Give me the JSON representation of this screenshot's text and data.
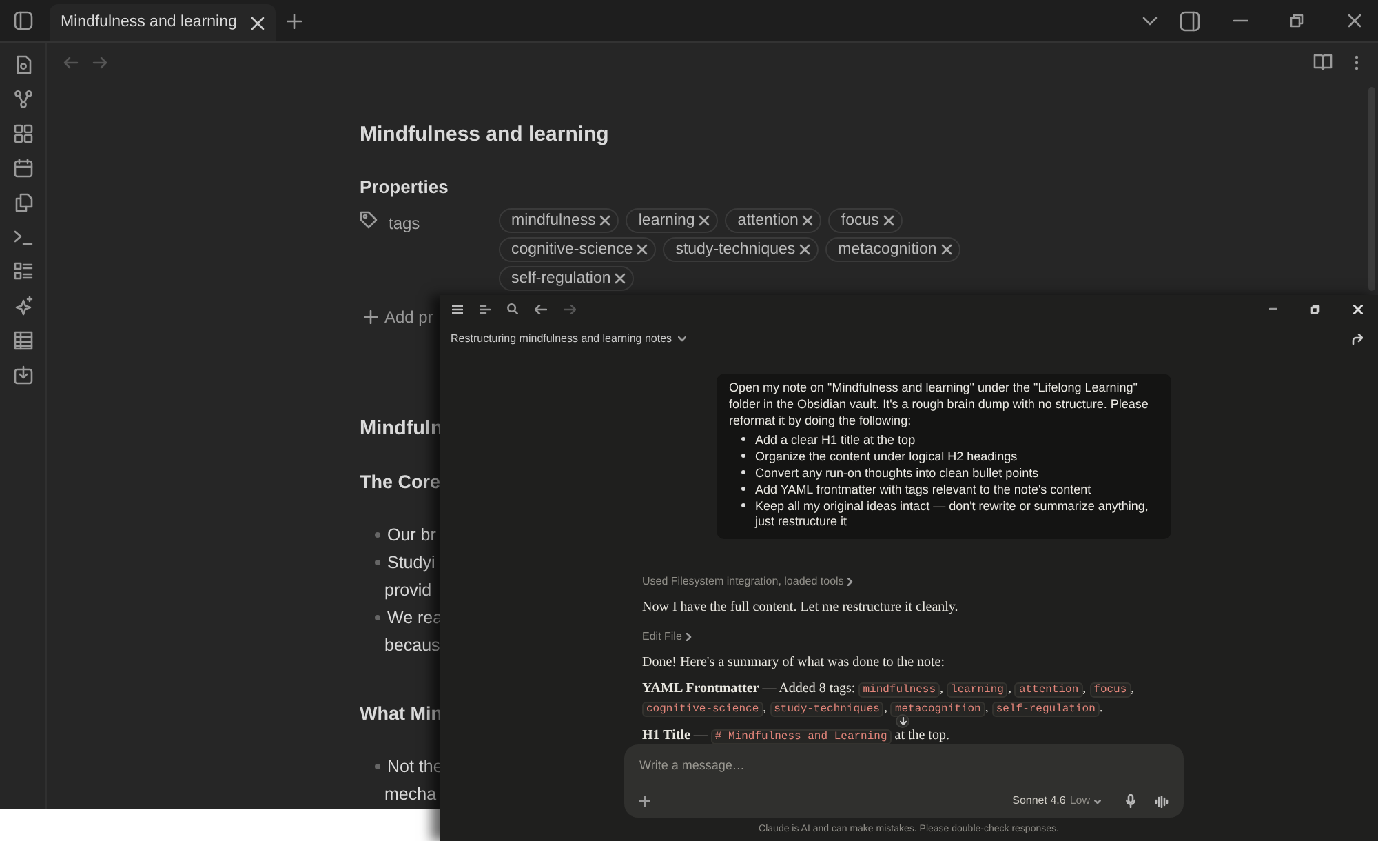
{
  "tabs": [
    {
      "label": "Mindfulness and learning",
      "selected": true
    }
  ],
  "note": {
    "title": "Mindfulness and learning",
    "properties_heading": "Properties",
    "property": {
      "name": "tags",
      "tags": [
        "mindfulness",
        "learning",
        "attention",
        "focus",
        "cognitive-science",
        "study-techniques",
        "metacognition",
        "self-regulation"
      ]
    },
    "add_property": "Add pr",
    "body": [
      {
        "kind": "heading",
        "text": "Mindfuln"
      },
      {
        "kind": "subheading",
        "text": "The Core"
      },
      {
        "kind": "bullet",
        "text": "Our br"
      },
      {
        "kind": "bullet",
        "text": "Studyi"
      },
      {
        "kind": "continuation",
        "text": "provid"
      },
      {
        "kind": "bullet",
        "text": "We rea"
      },
      {
        "kind": "continuation",
        "text": "becaus"
      },
      {
        "kind": "subheading",
        "text": "What Min"
      },
      {
        "kind": "bullet",
        "text": "Not the"
      },
      {
        "kind": "continuation",
        "text": "mecha"
      }
    ]
  },
  "chat_window": {
    "title": "Restructuring mindfulness and learning notes",
    "user_message": {
      "intro": "Open my note on \"Mindfulness and learning\" under the \"Lifelong Learning\" folder in the Obsidian vault. It's a rough brain dump with no structure. Please reformat it by doing the following:",
      "points": [
        "Add a clear H1 title at the top",
        "Organize the content under logical H2 headings",
        "Convert any run-on thoughts into clean bullet points",
        "Add YAML frontmatter with tags relevant to the note's content",
        "Keep all my original ideas intact — don't rewrite or summarize anything, just restructure it"
      ]
    },
    "assistant": [
      {
        "kind": "tool",
        "text": "Used Filesystem integration, loaded tools"
      },
      {
        "kind": "text",
        "text": "Now I have the full content. Let me restructure it cleanly."
      },
      {
        "kind": "tool",
        "text": "Edit File"
      },
      {
        "kind": "text",
        "text": "Done! Here's a summary of what was done to the note:"
      },
      {
        "kind": "summary",
        "label": "YAML Frontmatter",
        "text": "— Added 8 tags:",
        "codes": [
          "mindfulness",
          "learning",
          "attention",
          "focus",
          "cognitive-science",
          "study-techniques",
          "metacognition",
          "self-regulation"
        ],
        "separator": ",",
        "end": "."
      },
      {
        "kind": "summary",
        "label": "H1 Title",
        "text": "—",
        "codes": [
          "# Mindfulness and Learning"
        ],
        "end": "at the top."
      }
    ],
    "composer": {
      "placeholder": "Write a message…",
      "model": "Sonnet 4.6",
      "effort": "Low"
    },
    "disclaimer": "Claude is AI and can make mistakes. Please double-check responses."
  }
}
